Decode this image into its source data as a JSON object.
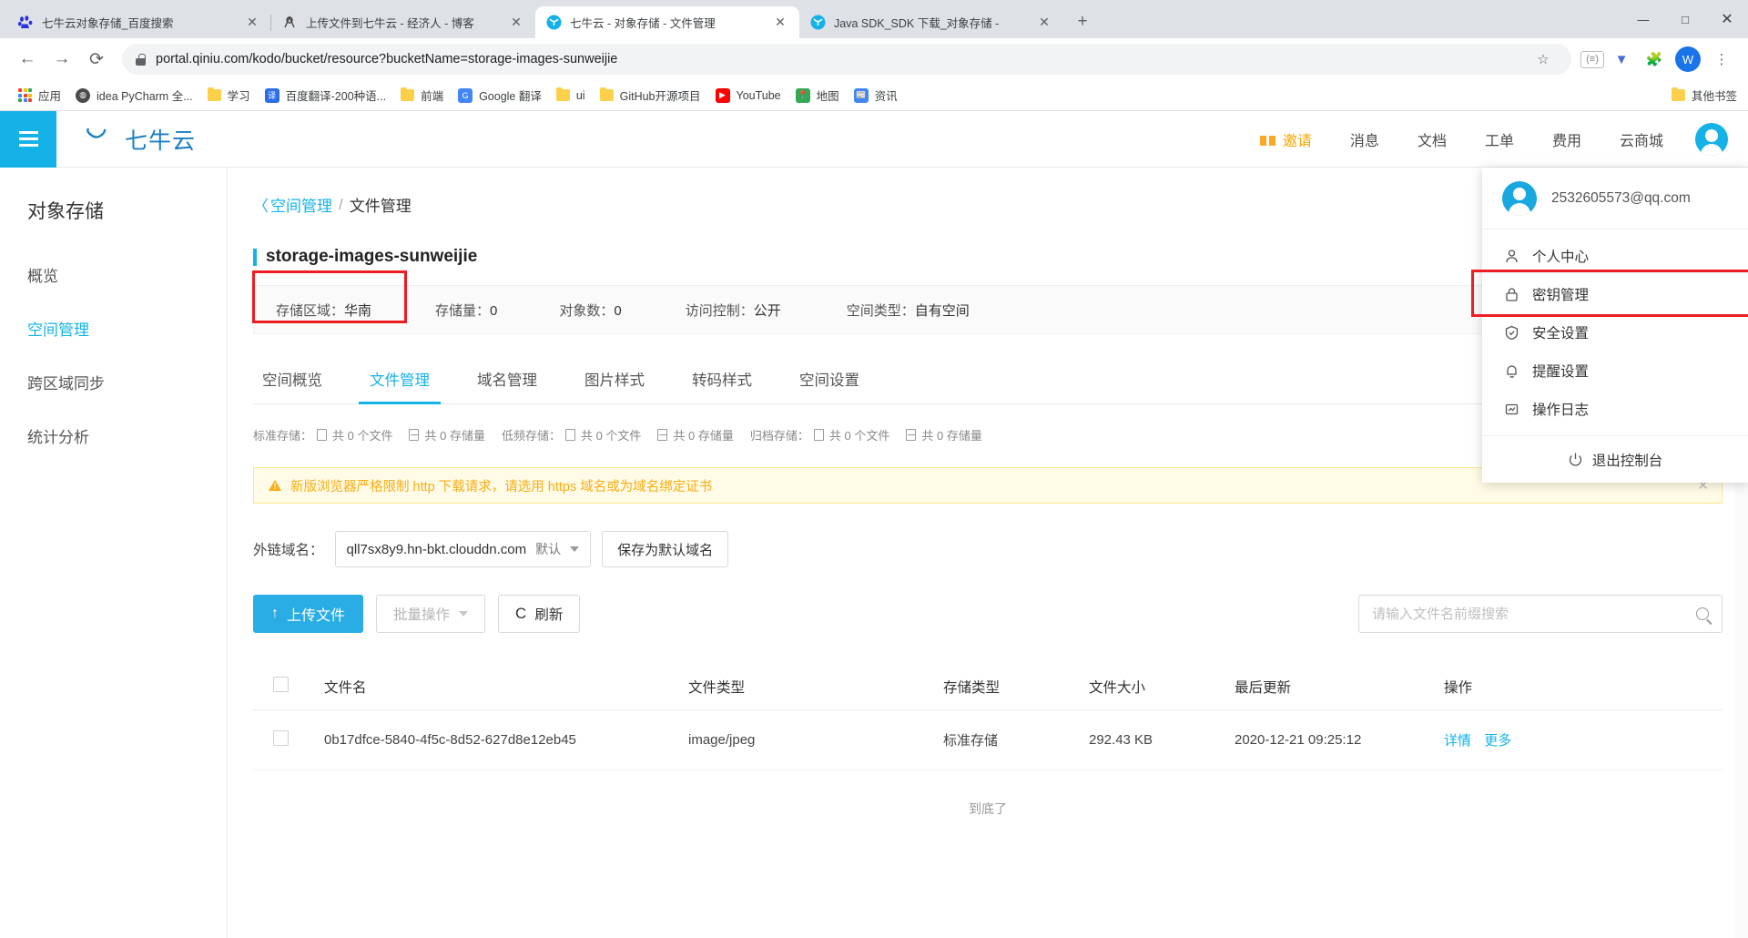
{
  "browser": {
    "tabs": [
      {
        "title": "七牛云对象存储_百度搜索",
        "favicon": "baidu-icon",
        "active": false
      },
      {
        "title": "上传文件到七牛云 - 经济人 - 博客",
        "favicon": "blog-icon",
        "active": false
      },
      {
        "title": "七牛云 - 对象存储 - 文件管理",
        "favicon": "qiniu-icon",
        "active": true
      },
      {
        "title": "Java SDK_SDK 下载_对象存储 -",
        "favicon": "qiniu-icon",
        "active": false
      }
    ],
    "new_tab_label": "+",
    "window_controls": {
      "minimize": "—",
      "maximize": "□",
      "close": "✕"
    },
    "nav": {
      "back": "←",
      "forward": "→",
      "reload": "⟳"
    },
    "url": "portal.qiniu.com/kodo/bucket/resource?bucketName=storage-images-sunweijie",
    "omnibox_icons": [
      "star-icon",
      "extension-badge-icon",
      "vimium-icon",
      "puzzle-icon"
    ],
    "profile_initial": "W",
    "menu_label": "⋮",
    "bookmarks": [
      {
        "label": "应用",
        "icon": "apps-grid-icon"
      },
      {
        "label": "idea PyCharm 全...",
        "icon": "globe-icon"
      },
      {
        "label": "学习",
        "icon": "folder-icon"
      },
      {
        "label": "百度翻译-200种语...",
        "icon": "translate-icon"
      },
      {
        "label": "前端",
        "icon": "folder-icon"
      },
      {
        "label": "Google 翻译",
        "icon": "gtranslate-icon"
      },
      {
        "label": "ui",
        "icon": "folder-icon"
      },
      {
        "label": "GitHub开源项目",
        "icon": "folder-icon"
      },
      {
        "label": "YouTube",
        "icon": "youtube-icon"
      },
      {
        "label": "地图",
        "icon": "maps-icon"
      },
      {
        "label": "资讯",
        "icon": "news-icon"
      }
    ],
    "other_bookmarks": "其他书签"
  },
  "header": {
    "brand": "七牛云",
    "nav": [
      {
        "label": "邀请",
        "icon": "gift-icon",
        "highlight": true
      },
      {
        "label": "消息",
        "icon": null,
        "highlight": false
      },
      {
        "label": "文档",
        "icon": null,
        "highlight": false
      },
      {
        "label": "工单",
        "icon": null,
        "highlight": false
      },
      {
        "label": "费用",
        "icon": null,
        "highlight": false
      },
      {
        "label": "云商城",
        "icon": null,
        "highlight": false
      }
    ]
  },
  "sidebar": {
    "title": "对象存储",
    "items": [
      {
        "label": "概览",
        "active": false
      },
      {
        "label": "空间管理",
        "active": true
      },
      {
        "label": "跨区域同步",
        "active": false
      },
      {
        "label": "统计分析",
        "active": false
      }
    ]
  },
  "breadcrumb": {
    "back_arrow": "〈",
    "parent": "空间管理",
    "separator": "/",
    "current": "文件管理"
  },
  "bucket": {
    "name": "storage-images-sunweijie",
    "stats": [
      {
        "label": "存储区域：",
        "value": "华南",
        "highlighted": true
      },
      {
        "label": "存储量：",
        "value": "0",
        "highlighted": false
      },
      {
        "label": "对象数：",
        "value": "0",
        "highlighted": false
      },
      {
        "label": "访问控制：",
        "value": "公开",
        "highlighted": false
      },
      {
        "label": "空间类型：",
        "value": "自有空间",
        "highlighted": false
      }
    ]
  },
  "tabs": [
    {
      "label": "空间概览",
      "active": false
    },
    {
      "label": "文件管理",
      "active": true
    },
    {
      "label": "域名管理",
      "active": false
    },
    {
      "label": "图片样式",
      "active": false
    },
    {
      "label": "转码样式",
      "active": false
    },
    {
      "label": "空间设置",
      "active": false
    }
  ],
  "storage_summary": [
    {
      "label": "标准存储：",
      "files": "共 0 个文件",
      "size": "共 0 存储量"
    },
    {
      "label": "低频存储：",
      "files": "共 0 个文件",
      "size": "共 0 存储量"
    },
    {
      "label": "归档存储：",
      "files": "共 0 个文件",
      "size": "共 0 存储量"
    }
  ],
  "warning": {
    "text": "新版浏览器严格限制 http 下载请求，请选用 https 域名或为域名绑定证书",
    "close": "✕"
  },
  "domain": {
    "label": "外链域名：",
    "value": "qll7sx8y9.hn-bkt.clouddn.com",
    "tag": "默认",
    "save_button": "保存为默认域名"
  },
  "toolbar": {
    "upload_label": "上传文件",
    "upload_icon": "↑",
    "batch_label": "批量操作",
    "refresh_label": "刷新",
    "refresh_icon": "C",
    "search_placeholder": "请输入文件名前缀搜索",
    "search_value": ""
  },
  "table": {
    "columns": [
      "文件名",
      "文件类型",
      "存储类型",
      "文件大小",
      "最后更新",
      "操作"
    ],
    "rows": [
      {
        "name": "0b17dfce-5840-4f5c-8d52-627d8e12eb45",
        "type": "image/jpeg",
        "storage": "标准存储",
        "size": "292.43 KB",
        "updated": "2020-12-21 09:25:12",
        "actions": [
          "详情",
          "更多"
        ]
      }
    ],
    "end_text": "到底了"
  },
  "user_menu": {
    "email": "2532605573@qq.com",
    "items": [
      {
        "label": "个人中心",
        "icon": "person-icon",
        "highlighted": false
      },
      {
        "label": "密钥管理",
        "icon": "lock-icon",
        "highlighted": true
      },
      {
        "label": "安全设置",
        "icon": "shield-check-icon",
        "highlighted": false
      },
      {
        "label": "提醒设置",
        "icon": "bell-icon",
        "highlighted": false
      },
      {
        "label": "操作日志",
        "icon": "log-icon",
        "highlighted": false
      }
    ],
    "logout": {
      "label": "退出控制台",
      "icon": "power-icon"
    }
  },
  "colors": {
    "brand": "#15b2e8",
    "primary_button": "#29ade4",
    "highlight_box": "#ee1c25",
    "warning_bg": "#fffbe6",
    "warning_text": "#faad14"
  }
}
